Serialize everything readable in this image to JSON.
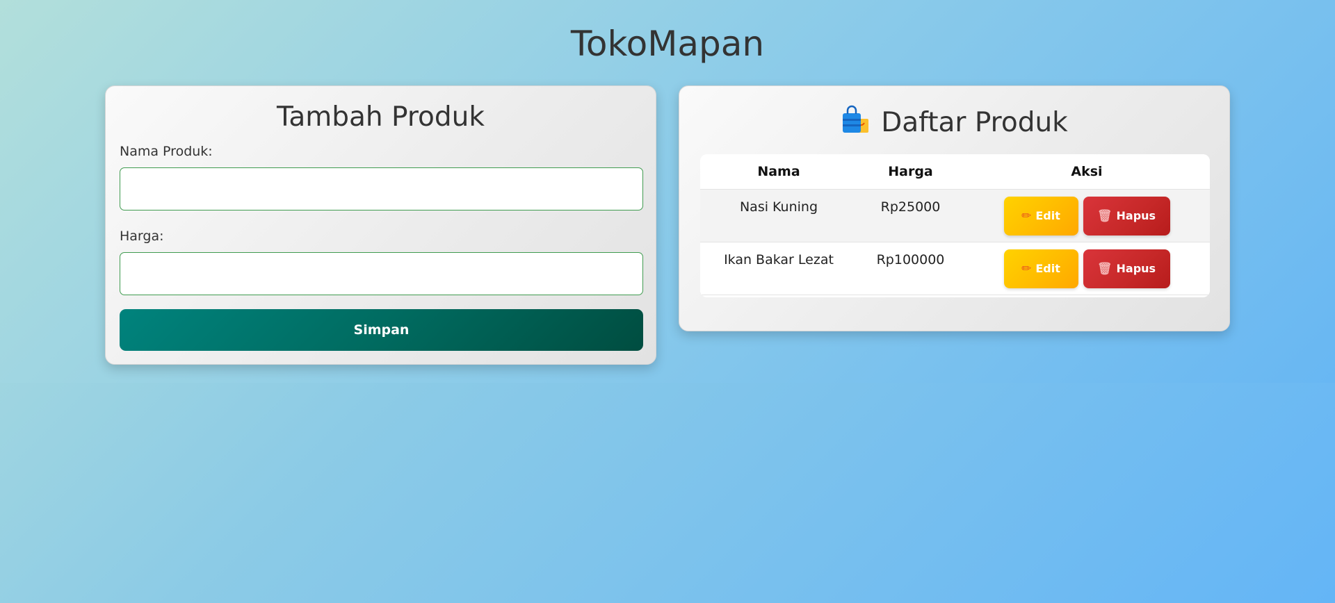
{
  "app": {
    "title": "TokoMapan"
  },
  "form": {
    "title": "Tambah Produk",
    "name_label": "Nama Produk:",
    "name_value": "",
    "price_label": "Harga:",
    "price_value": "",
    "submit_label": "Simpan"
  },
  "list": {
    "title": "Daftar Produk",
    "title_icon": "shopping-bags-icon",
    "columns": [
      "Nama",
      "Harga",
      "Aksi"
    ],
    "rows": [
      {
        "name": "Nasi Kuning",
        "price": "Rp25000",
        "edit_label": "Edit",
        "delete_label": "Hapus"
      },
      {
        "name": "Ikan Bakar Lezat",
        "price": "Rp100000",
        "edit_label": "Edit",
        "delete_label": "Hapus"
      }
    ]
  },
  "icons": {
    "edit": "pencil-icon",
    "delete": "trash-icon"
  },
  "colors": {
    "primary_button": "#00695c",
    "edit_button": "#ffc107",
    "delete_button": "#c62828",
    "input_border": "#3f9b4f",
    "background_start": "#b2dfdb",
    "background_end": "#64b5f6"
  }
}
